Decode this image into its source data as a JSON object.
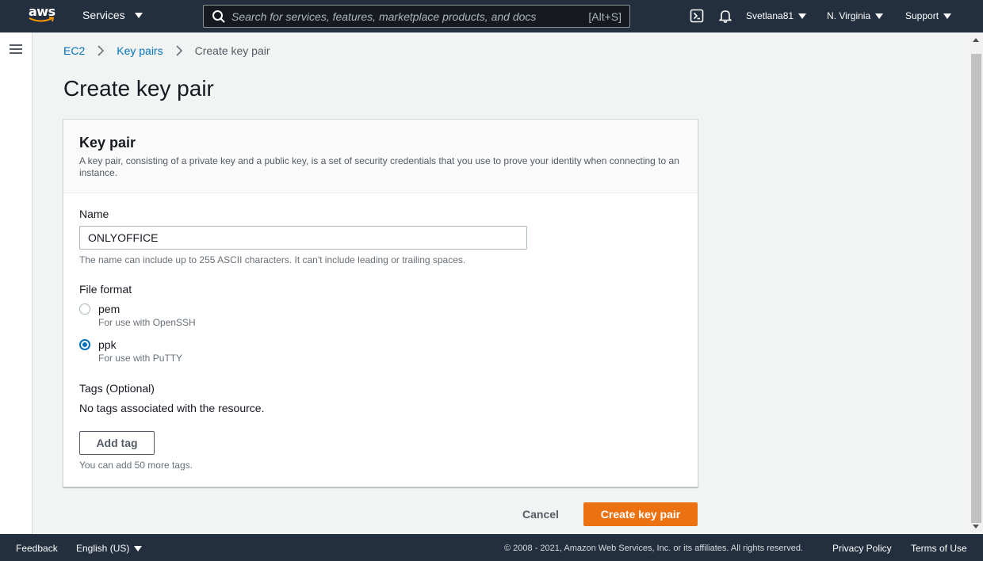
{
  "nav": {
    "logo_text": "aws",
    "services_label": "Services",
    "search_placeholder": "Search for services, features, marketplace products, and docs",
    "search_shortcut": "[Alt+S]",
    "user": "Svetlana81",
    "region": "N. Virginia",
    "support": "Support"
  },
  "breadcrumb": {
    "items": [
      "EC2",
      "Key pairs"
    ],
    "current": "Create key pair"
  },
  "page": {
    "title": "Create key pair"
  },
  "card": {
    "title": "Key pair",
    "description": "A key pair, consisting of a private key and a public key, is a set of security credentials that you use to prove your identity when connecting to an instance.",
    "name_label": "Name",
    "name_value": "ONLYOFFICE",
    "name_hint": "The name can include up to 255 ASCII characters. It can't include leading or trailing spaces.",
    "format_label": "File format",
    "formats": [
      {
        "label": "pem",
        "hint": "For use with OpenSSH",
        "checked": false
      },
      {
        "label": "ppk",
        "hint": "For use with PuTTY",
        "checked": true
      }
    ],
    "tags_label": "Tags (Optional)",
    "tags_empty": "No tags associated with the resource.",
    "add_tag_label": "Add tag",
    "tags_hint": "You can add 50 more tags."
  },
  "actions": {
    "cancel_label": "Cancel",
    "create_label": "Create key pair"
  },
  "footer": {
    "feedback": "Feedback",
    "language": "English (US)",
    "copyright": "© 2008 - 2021, Amazon Web Services, Inc. or its affiliates. All rights reserved.",
    "privacy": "Privacy Policy",
    "terms": "Terms of Use"
  },
  "colors": {
    "nav_bg": "#232f3e",
    "link": "#0073bb",
    "primary": "#ec7211",
    "page_bg": "#f2f3f3"
  }
}
